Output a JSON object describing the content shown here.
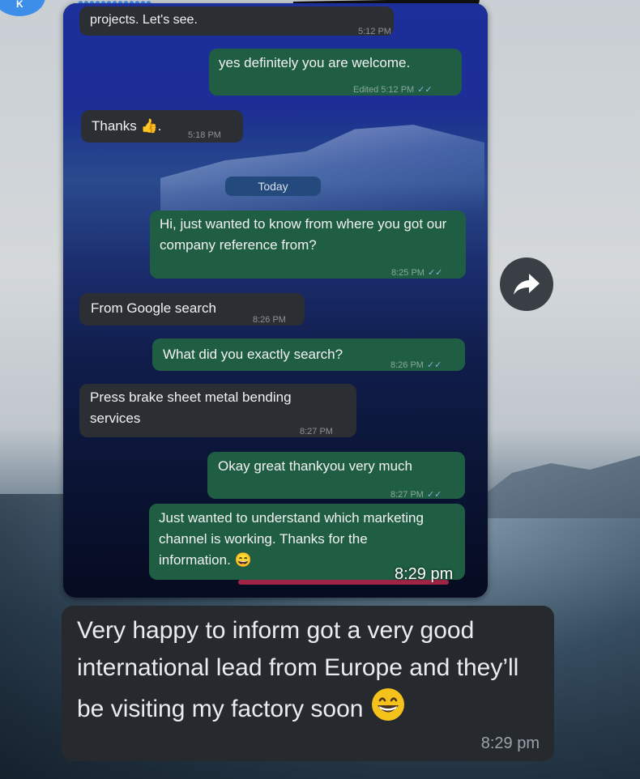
{
  "main_reply": {
    "text": "Very happy to inform got a very good international lead from Europe and they’ll be visiting my factory soon",
    "emoji": "grinning-face",
    "time": "8:29 pm"
  },
  "quoted_chat": {
    "overlay_time": "8:29 pm",
    "date_divider": "Today",
    "messages": [
      {
        "direction": "in",
        "text": "projects. Let's see.",
        "time": "5:12 PM"
      },
      {
        "direction": "out",
        "text": "yes definitely you are welcome.",
        "time": "Edited 5:12 PM"
      },
      {
        "direction": "in",
        "text": "Thanks",
        "emoji": "thumbs-up",
        "suffix": ".",
        "time": "5:18 PM"
      },
      {
        "direction": "out",
        "text": "Hi, just wanted to know from where you got our company reference from?",
        "time": "8:25 PM"
      },
      {
        "direction": "in",
        "text": "From Google search",
        "time": "8:26 PM"
      },
      {
        "direction": "out",
        "text": "What did you exactly search?",
        "time": "8:26 PM"
      },
      {
        "direction": "in",
        "text": "Press brake sheet metal bending services",
        "time": "8:27 PM"
      },
      {
        "direction": "out",
        "text": "Okay great thankyou very much",
        "time": "8:27 PM"
      },
      {
        "direction": "out",
        "text": "Just wanted to understand which marketing channel is working. Thanks for the information.",
        "emoji": "grinning-face"
      }
    ]
  },
  "colors": {
    "incoming_bubble": "#2b2e33",
    "outgoing_bubble": "#1f5e43",
    "read_tick": "#7fb4e0",
    "forward_button": "#3a3f45"
  },
  "icons": {
    "forward": "share-forward-icon",
    "read_receipt": "double-check-icon"
  }
}
